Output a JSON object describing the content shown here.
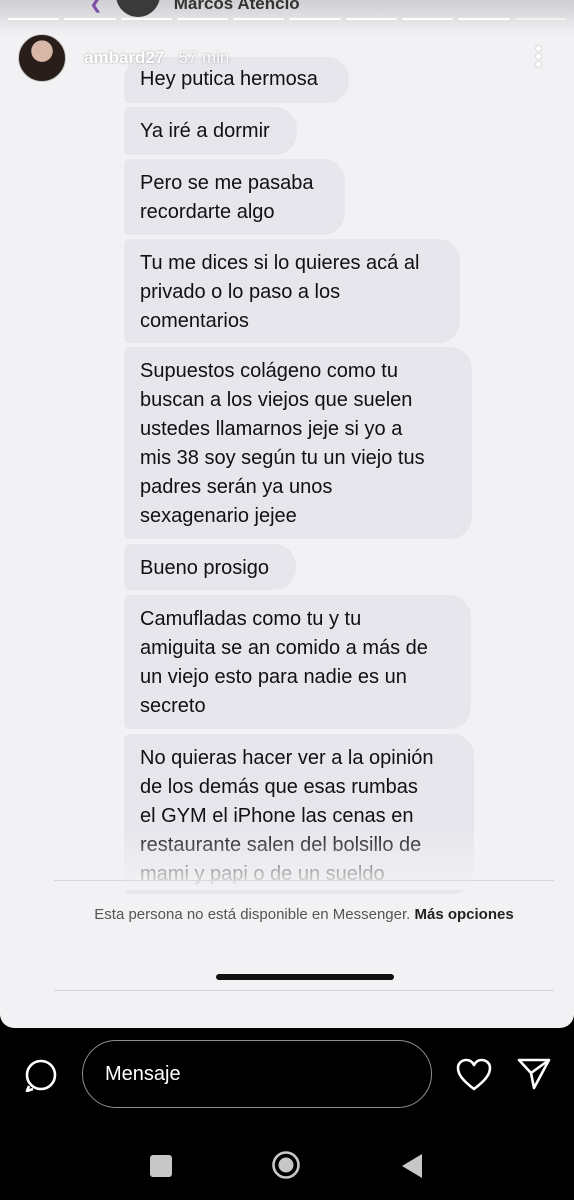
{
  "previous_header": {
    "name": "Marcos Atencio"
  },
  "story": {
    "username": "ambard27",
    "time": "57 min",
    "progress_segments": 10
  },
  "messages": [
    "Hey putica hermosa",
    "Ya iré a dormir",
    "Pero se me pasaba\nrecordarte algo",
    "Tu me dices si lo quieres acá al\nprivado o lo paso a los\ncomentarios",
    "Supuestos colágeno como tu\nbuscan a los viejos que suelen\nustedes llamarnos jeje si yo a\nmis 38 soy según tu un viejo tus\npadres serán ya unos\nsexagenario jejee",
    "Bueno prosigo",
    "Camufladas como tu y tu\namiguita se an comido a más de\nun viejo esto para nadie es un\nsecreto",
    "No quieras hacer ver a la opinión\nde los demás que esas rumbas\nel GYM el iPhone las cenas en\nrestaurante salen del bolsillo de\nmami y papi o de un sueldo"
  ],
  "notice": {
    "text": "Esta persona no está disponible en Messenger.",
    "link": "Más opciones"
  },
  "reply": {
    "placeholder": "Mensaje",
    "icons": {
      "camera": "camera-icon",
      "like": "heart-icon",
      "send": "send-icon"
    }
  },
  "colors": {
    "bubble": "#e6e6ec",
    "background": "#f2f2f4",
    "bar": "#000000"
  }
}
